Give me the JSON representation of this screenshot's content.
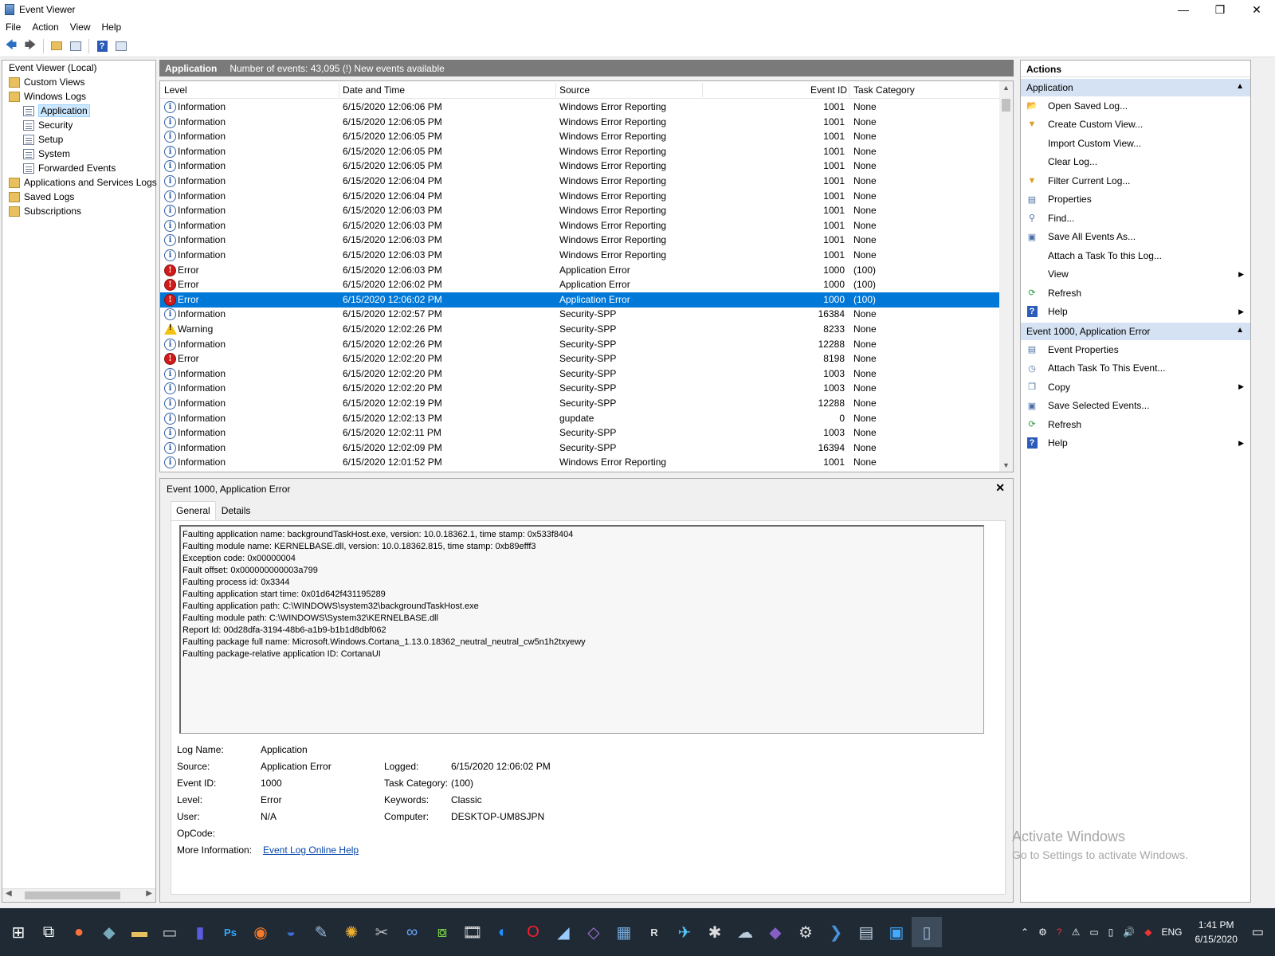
{
  "window": {
    "title": "Event Viewer",
    "min": "—",
    "max": "❐",
    "close": "✕"
  },
  "menu": [
    "File",
    "Action",
    "View",
    "Help"
  ],
  "tree": {
    "root": "Event Viewer (Local)",
    "custom_views": "Custom Views",
    "windows_logs": "Windows Logs",
    "logs": [
      "Application",
      "Security",
      "Setup",
      "System",
      "Forwarded Events"
    ],
    "app_services": "Applications and Services Logs",
    "saved_logs": "Saved Logs",
    "subscriptions": "Subscriptions"
  },
  "center": {
    "log_name": "Application",
    "summary": "Number of events: 43,095 (!) New events available",
    "columns": [
      "Level",
      "Date and Time",
      "Source",
      "Event ID",
      "Task Category"
    ],
    "rows": [
      {
        "level": "Information",
        "date": "6/15/2020 12:06:06 PM",
        "source": "Windows Error Reporting",
        "id": "1001",
        "cat": "None"
      },
      {
        "level": "Information",
        "date": "6/15/2020 12:06:05 PM",
        "source": "Windows Error Reporting",
        "id": "1001",
        "cat": "None"
      },
      {
        "level": "Information",
        "date": "6/15/2020 12:06:05 PM",
        "source": "Windows Error Reporting",
        "id": "1001",
        "cat": "None"
      },
      {
        "level": "Information",
        "date": "6/15/2020 12:06:05 PM",
        "source": "Windows Error Reporting",
        "id": "1001",
        "cat": "None"
      },
      {
        "level": "Information",
        "date": "6/15/2020 12:06:05 PM",
        "source": "Windows Error Reporting",
        "id": "1001",
        "cat": "None"
      },
      {
        "level": "Information",
        "date": "6/15/2020 12:06:04 PM",
        "source": "Windows Error Reporting",
        "id": "1001",
        "cat": "None"
      },
      {
        "level": "Information",
        "date": "6/15/2020 12:06:04 PM",
        "source": "Windows Error Reporting",
        "id": "1001",
        "cat": "None"
      },
      {
        "level": "Information",
        "date": "6/15/2020 12:06:03 PM",
        "source": "Windows Error Reporting",
        "id": "1001",
        "cat": "None"
      },
      {
        "level": "Information",
        "date": "6/15/2020 12:06:03 PM",
        "source": "Windows Error Reporting",
        "id": "1001",
        "cat": "None"
      },
      {
        "level": "Information",
        "date": "6/15/2020 12:06:03 PM",
        "source": "Windows Error Reporting",
        "id": "1001",
        "cat": "None"
      },
      {
        "level": "Information",
        "date": "6/15/2020 12:06:03 PM",
        "source": "Windows Error Reporting",
        "id": "1001",
        "cat": "None"
      },
      {
        "level": "Error",
        "date": "6/15/2020 12:06:03 PM",
        "source": "Application Error",
        "id": "1000",
        "cat": "(100)"
      },
      {
        "level": "Error",
        "date": "6/15/2020 12:06:02 PM",
        "source": "Application Error",
        "id": "1000",
        "cat": "(100)"
      },
      {
        "level": "Error",
        "date": "6/15/2020 12:06:02 PM",
        "source": "Application Error",
        "id": "1000",
        "cat": "(100)",
        "selected": true
      },
      {
        "level": "Information",
        "date": "6/15/2020 12:02:57 PM",
        "source": "Security-SPP",
        "id": "16384",
        "cat": "None"
      },
      {
        "level": "Warning",
        "date": "6/15/2020 12:02:26 PM",
        "source": "Security-SPP",
        "id": "8233",
        "cat": "None"
      },
      {
        "level": "Information",
        "date": "6/15/2020 12:02:26 PM",
        "source": "Security-SPP",
        "id": "12288",
        "cat": "None"
      },
      {
        "level": "Error",
        "date": "6/15/2020 12:02:20 PM",
        "source": "Security-SPP",
        "id": "8198",
        "cat": "None"
      },
      {
        "level": "Information",
        "date": "6/15/2020 12:02:20 PM",
        "source": "Security-SPP",
        "id": "1003",
        "cat": "None"
      },
      {
        "level": "Information",
        "date": "6/15/2020 12:02:20 PM",
        "source": "Security-SPP",
        "id": "1003",
        "cat": "None"
      },
      {
        "level": "Information",
        "date": "6/15/2020 12:02:19 PM",
        "source": "Security-SPP",
        "id": "12288",
        "cat": "None"
      },
      {
        "level": "Information",
        "date": "6/15/2020 12:02:13 PM",
        "source": "gupdate",
        "id": "0",
        "cat": "None"
      },
      {
        "level": "Information",
        "date": "6/15/2020 12:02:11 PM",
        "source": "Security-SPP",
        "id": "1003",
        "cat": "None"
      },
      {
        "level": "Information",
        "date": "6/15/2020 12:02:09 PM",
        "source": "Security-SPP",
        "id": "16394",
        "cat": "None"
      },
      {
        "level": "Information",
        "date": "6/15/2020 12:01:52 PM",
        "source": "Windows Error Reporting",
        "id": "1001",
        "cat": "None"
      }
    ]
  },
  "detail": {
    "title": "Event 1000, Application Error",
    "tabs": [
      "General",
      "Details"
    ],
    "description": [
      "Faulting application name: backgroundTaskHost.exe, version: 10.0.18362.1, time stamp: 0x533f8404",
      "Faulting module name: KERNELBASE.dll, version: 10.0.18362.815, time stamp: 0xb89efff3",
      "Exception code: 0x00000004",
      "Fault offset: 0x000000000003a799",
      "Faulting process id: 0x3344",
      "Faulting application start time: 0x01d642f431195289",
      "Faulting application path: C:\\WINDOWS\\system32\\backgroundTaskHost.exe",
      "Faulting module path: C:\\WINDOWS\\System32\\KERNELBASE.dll",
      "Report Id: 00d28dfa-3194-48b6-a1b9-b1b1d8dbf062",
      "Faulting package full name: Microsoft.Windows.Cortana_1.13.0.18362_neutral_neutral_cw5n1h2txyewy",
      "Faulting package-relative application ID: CortanaUI"
    ],
    "props": {
      "log_name_label": "Log Name:",
      "log_name": "Application",
      "source_label": "Source:",
      "source": "Application Error",
      "logged_label": "Logged:",
      "logged": "6/15/2020 12:06:02 PM",
      "event_id_label": "Event ID:",
      "event_id": "1000",
      "task_cat_label": "Task Category:",
      "task_cat": "(100)",
      "level_label": "Level:",
      "level": "Error",
      "keywords_label": "Keywords:",
      "keywords": "Classic",
      "user_label": "User:",
      "user": "N/A",
      "computer_label": "Computer:",
      "computer": "DESKTOP-UM8SJPN",
      "opcode_label": "OpCode:",
      "more_info_label": "More Information:",
      "more_info_link": "Event Log Online Help"
    }
  },
  "actions": {
    "header": "Actions",
    "section1": "Application",
    "items1": [
      {
        "label": "Open Saved Log...",
        "icon": "open-folder-icon",
        "glyph": "📂"
      },
      {
        "label": "Create Custom View...",
        "icon": "filter-icon",
        "glyph": "▼"
      },
      {
        "label": "Import Custom View...",
        "icon": "",
        "glyph": ""
      },
      {
        "label": "Clear Log...",
        "icon": "",
        "glyph": ""
      },
      {
        "label": "Filter Current Log...",
        "icon": "filter-icon",
        "glyph": "▼"
      },
      {
        "label": "Properties",
        "icon": "properties-icon",
        "glyph": "▤"
      },
      {
        "label": "Find...",
        "icon": "find-icon",
        "glyph": "⚲"
      },
      {
        "label": "Save All Events As...",
        "icon": "save-icon",
        "glyph": "▣"
      },
      {
        "label": "Attach a Task To this Log...",
        "icon": "",
        "glyph": ""
      },
      {
        "label": "View",
        "icon": "",
        "glyph": "",
        "submenu": true
      },
      {
        "label": "Refresh",
        "icon": "refresh-icon",
        "glyph": "⟳"
      },
      {
        "label": "Help",
        "icon": "help-icon",
        "glyph": "?",
        "submenu": true
      }
    ],
    "section2": "Event 1000, Application Error",
    "items2": [
      {
        "label": "Event Properties",
        "icon": "properties-icon",
        "glyph": "▤"
      },
      {
        "label": "Attach Task To This Event...",
        "icon": "task-icon",
        "glyph": "◷"
      },
      {
        "label": "Copy",
        "icon": "copy-icon",
        "glyph": "❐",
        "submenu": true
      },
      {
        "label": "Save Selected Events...",
        "icon": "save-icon",
        "glyph": "▣"
      },
      {
        "label": "Refresh",
        "icon": "refresh-icon",
        "glyph": "⟳"
      },
      {
        "label": "Help",
        "icon": "help-icon",
        "glyph": "?",
        "submenu": true
      }
    ]
  },
  "watermark": {
    "line1": "Activate Windows",
    "line2": "Go to Settings to activate Windows."
  },
  "taskbar": {
    "lang": "ENG",
    "time": "1:41 PM",
    "date": "6/15/2020"
  }
}
